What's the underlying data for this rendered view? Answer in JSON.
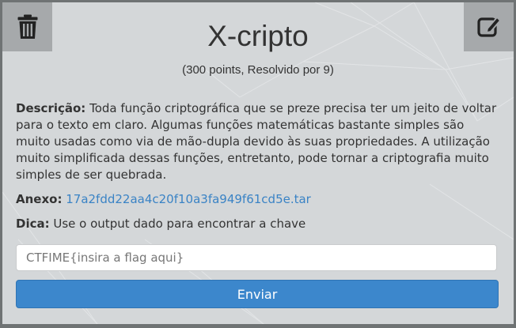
{
  "challenge": {
    "title": "X-cripto",
    "points_info": "(300 points, Resolvido por 9)",
    "description_label": "Descrição:",
    "description_text": "Toda função criptográfica que se preze precisa ter um jeito de voltar para o texto em claro. Algumas funções matemáticas bastante simples são muito usadas como via de mão-dupla devido às suas propriedades. A utilização muito simplificada dessas funções, entretanto, pode tornar a criptografia muito simples de ser quebrada.",
    "attachment_label": "Anexo:",
    "attachment_link": "17a2fdd22aa4c20f10a3fa949f61cd5e.tar",
    "hint_label": "Dica:",
    "hint_text": "Use o output dado para encontrar a chave"
  },
  "form": {
    "flag_placeholder": "CTFIME{insira a flag aqui}",
    "flag_value": "",
    "submit_label": "Enviar"
  },
  "toolbar": {
    "delete_icon": "trash-icon",
    "edit_icon": "edit-icon"
  },
  "colors": {
    "card_background": "#d4d7d9",
    "corner_button": "#a6a9ab",
    "link": "#3a83c5",
    "primary_button": "#3c87cc"
  }
}
